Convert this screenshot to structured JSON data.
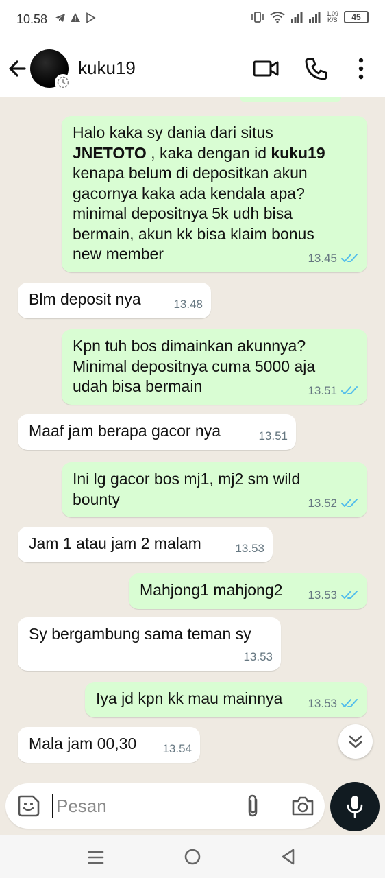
{
  "status_bar": {
    "time": "10.58",
    "net_speed_value": "1,09",
    "net_speed_unit": "K/S",
    "battery": "45"
  },
  "header": {
    "contact_name": "kuku19"
  },
  "messages": [
    {
      "direction": "out",
      "line1": "Halo kaka sy dania dari situs",
      "bold1": "JNETOTO",
      "mid": " , kaka dengan id  ",
      "bold2": "kuku19",
      "rest": "kenapa belum di depositkan akun\ngacornya kaka ada kendala apa?\nminimal depositnya 5k udh bisa\nbermain, akun kk bisa klaim bonus\nnew member",
      "time": "13.45",
      "status": "read"
    },
    {
      "direction": "in",
      "text": "Blm  deposit nya",
      "time": "13.48"
    },
    {
      "direction": "out",
      "text": "Kpn tuh bos dimainkan akunnya?\nMinimal depositnya cuma 5000 aja\nudah bisa bermain",
      "time": "13.51",
      "status": "read"
    },
    {
      "direction": "in",
      "text": "Maaf jam  berapa gacor nya",
      "time": "13.51"
    },
    {
      "direction": "out",
      "text": "Ini lg gacor bos mj1, mj2 sm wild\nbounty",
      "time": "13.52",
      "status": "read"
    },
    {
      "direction": "in",
      "text": "Jam 1 atau jam 2 malam",
      "time": "13.53"
    },
    {
      "direction": "out",
      "text": "Mahjong1 mahjong2",
      "time": "13.53",
      "status": "read"
    },
    {
      "direction": "in",
      "text": "Sy bergambung sama teman sy",
      "time": "13.53"
    },
    {
      "direction": "out",
      "text": "Iya jd kpn kk mau mainnya",
      "time": "13.53",
      "status": "read"
    },
    {
      "direction": "in",
      "text": "Mala jam 00,30",
      "time": "13.54"
    }
  ],
  "composer": {
    "placeholder": "Pesan",
    "value": ""
  },
  "colors": {
    "outgoing_bubble": "#d9fdd3",
    "incoming_bubble": "#ffffff",
    "chat_background": "#efeae2",
    "read_tick": "#53bdeb",
    "mic_button": "#111b21"
  },
  "icons": [
    "back-arrow-icon",
    "video-call-icon",
    "voice-call-icon",
    "more-options-icon",
    "double-check-icon",
    "scroll-down-icon",
    "sticker-icon",
    "attach-icon",
    "camera-icon",
    "mic-icon"
  ]
}
